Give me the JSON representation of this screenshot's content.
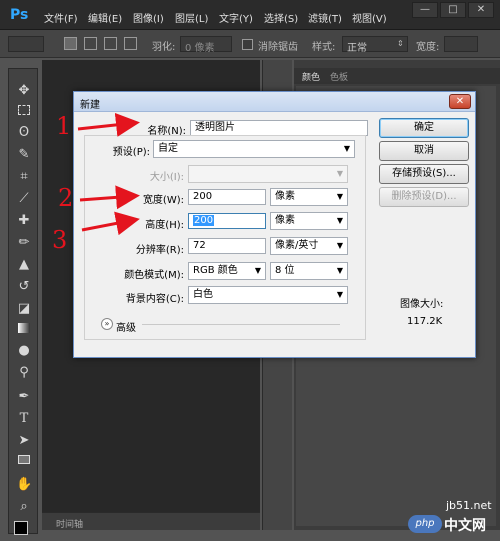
{
  "app": {
    "logo": "Ps"
  },
  "menu": [
    "文件(F)",
    "编辑(E)",
    "图像(I)",
    "图层(L)",
    "文字(Y)",
    "选择(S)",
    "滤镜(T)",
    "视图(V)"
  ],
  "window_controls": [
    "—",
    "□",
    "✕"
  ],
  "options_bar": {
    "feather_label": "羽化:",
    "feather_value": "0 像素",
    "antialias_label": "消除锯齿",
    "style_label": "样式:",
    "style_value": "正常",
    "width_label": "宽度:"
  },
  "tools": [
    "move-tool",
    "marquee-tool",
    "lasso-tool",
    "quick-select-tool",
    "crop-tool",
    "eyedropper-tool",
    "healing-brush-tool",
    "brush-tool",
    "clone-stamp-tool",
    "history-brush-tool",
    "eraser-tool",
    "gradient-tool",
    "blur-tool",
    "dodge-tool",
    "pen-tool",
    "type-tool",
    "path-select-tool",
    "rectangle-tool",
    "hand-tool",
    "zoom-tool"
  ],
  "panel": {
    "tabs": [
      "颜色",
      "色板"
    ]
  },
  "status": {
    "label": "时间轴"
  },
  "dialog": {
    "title": "新建",
    "close": "✕",
    "name_label": "名称(N):",
    "name_value": "透明图片",
    "preset_label": "预设(P):",
    "preset_value": "自定",
    "size_label": "大小(I):",
    "width_label": "宽度(W):",
    "width_value": "200",
    "width_unit": "像素",
    "height_label": "高度(H):",
    "height_value": "200",
    "height_unit": "像素",
    "resolution_label": "分辨率(R):",
    "resolution_value": "72",
    "resolution_unit": "像素/英寸",
    "color_mode_label": "颜色模式(M):",
    "color_mode_value": "RGB 颜色",
    "bit_depth_value": "8 位",
    "background_label": "背景内容(C):",
    "background_value": "白色",
    "advanced_label": "高级",
    "buttons": {
      "ok": "确定",
      "cancel": "取消",
      "save_preset": "存储预设(S)...",
      "delete_preset": "删除预设(D)..."
    },
    "image_size_label": "图像大小:",
    "image_size_value": "117.2K"
  },
  "annotations": [
    "1",
    "2",
    "3"
  ],
  "annotation_color": "#e4141e",
  "watermark": {
    "site": "jb51.net",
    "badge": "php",
    "cn": "中文网"
  }
}
